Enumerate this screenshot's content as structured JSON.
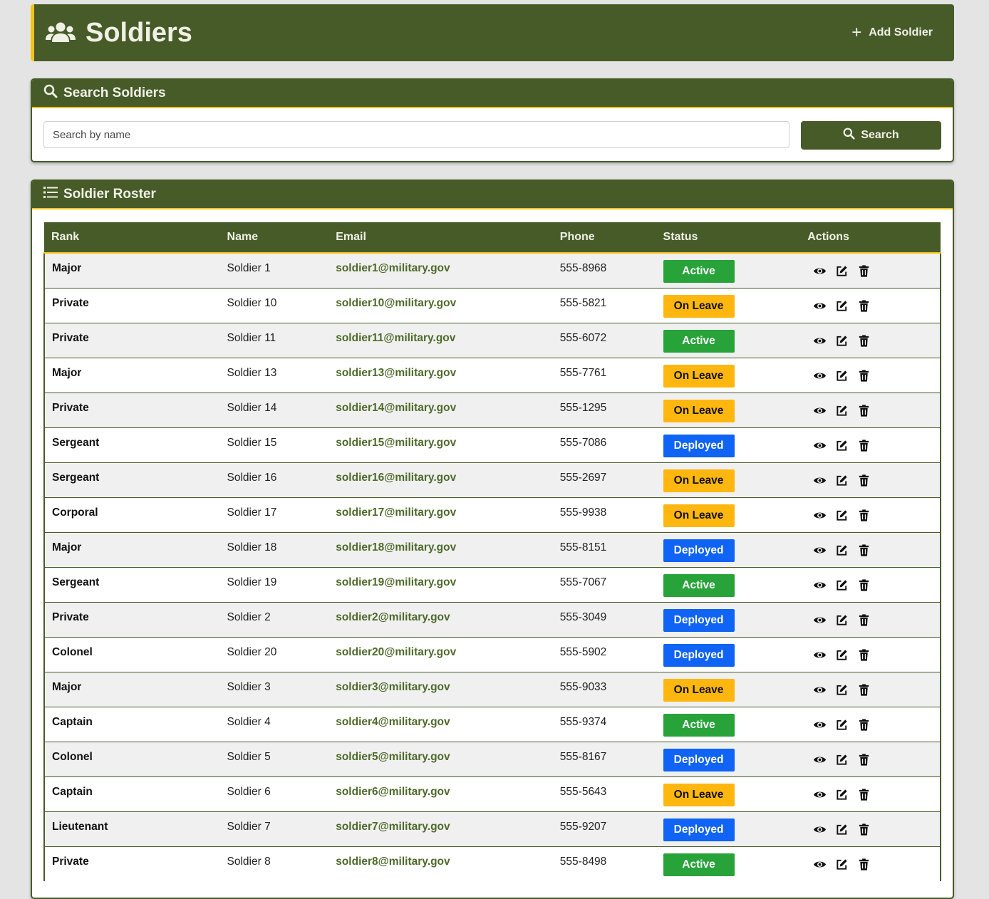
{
  "header": {
    "title": "Soldiers",
    "add_button_label": "Add Soldier"
  },
  "search": {
    "section_title": "Search Soldiers",
    "placeholder": "Search by name",
    "value": "",
    "button_label": "Search"
  },
  "roster": {
    "section_title": "Soldier Roster",
    "columns": [
      "Rank",
      "Name",
      "Email",
      "Phone",
      "Status",
      "Actions"
    ],
    "rows": [
      {
        "rank": "Major",
        "name": "Soldier 1",
        "email": "soldier1@military.gov",
        "phone": "555-8968",
        "status": "Active"
      },
      {
        "rank": "Private",
        "name": "Soldier 10",
        "email": "soldier10@military.gov",
        "phone": "555-5821",
        "status": "On Leave"
      },
      {
        "rank": "Private",
        "name": "Soldier 11",
        "email": "soldier11@military.gov",
        "phone": "555-6072",
        "status": "Active"
      },
      {
        "rank": "Major",
        "name": "Soldier 13",
        "email": "soldier13@military.gov",
        "phone": "555-7761",
        "status": "On Leave"
      },
      {
        "rank": "Private",
        "name": "Soldier 14",
        "email": "soldier14@military.gov",
        "phone": "555-1295",
        "status": "On Leave"
      },
      {
        "rank": "Sergeant",
        "name": "Soldier 15",
        "email": "soldier15@military.gov",
        "phone": "555-7086",
        "status": "Deployed"
      },
      {
        "rank": "Sergeant",
        "name": "Soldier 16",
        "email": "soldier16@military.gov",
        "phone": "555-2697",
        "status": "On Leave"
      },
      {
        "rank": "Corporal",
        "name": "Soldier 17",
        "email": "soldier17@military.gov",
        "phone": "555-9938",
        "status": "On Leave"
      },
      {
        "rank": "Major",
        "name": "Soldier 18",
        "email": "soldier18@military.gov",
        "phone": "555-8151",
        "status": "Deployed"
      },
      {
        "rank": "Sergeant",
        "name": "Soldier 19",
        "email": "soldier19@military.gov",
        "phone": "555-7067",
        "status": "Active"
      },
      {
        "rank": "Private",
        "name": "Soldier 2",
        "email": "soldier2@military.gov",
        "phone": "555-3049",
        "status": "Deployed"
      },
      {
        "rank": "Colonel",
        "name": "Soldier 20",
        "email": "soldier20@military.gov",
        "phone": "555-5902",
        "status": "Deployed"
      },
      {
        "rank": "Major",
        "name": "Soldier 3",
        "email": "soldier3@military.gov",
        "phone": "555-9033",
        "status": "On Leave"
      },
      {
        "rank": "Captain",
        "name": "Soldier 4",
        "email": "soldier4@military.gov",
        "phone": "555-9374",
        "status": "Active"
      },
      {
        "rank": "Colonel",
        "name": "Soldier 5",
        "email": "soldier5@military.gov",
        "phone": "555-8167",
        "status": "Deployed"
      },
      {
        "rank": "Captain",
        "name": "Soldier 6",
        "email": "soldier6@military.gov",
        "phone": "555-5643",
        "status": "On Leave"
      },
      {
        "rank": "Lieutenant",
        "name": "Soldier 7",
        "email": "soldier7@military.gov",
        "phone": "555-9207",
        "status": "Deployed"
      },
      {
        "rank": "Private",
        "name": "Soldier 8",
        "email": "soldier8@military.gov",
        "phone": "555-8498",
        "status": "Active"
      }
    ],
    "row_actions": [
      "eye-icon",
      "edit-icon",
      "trash-icon"
    ]
  },
  "colors": {
    "brand": "#475b29",
    "accent": "#f2c418",
    "active": "#27a33a",
    "on_leave": "#ffb70f",
    "deployed": "#0f63f5"
  }
}
